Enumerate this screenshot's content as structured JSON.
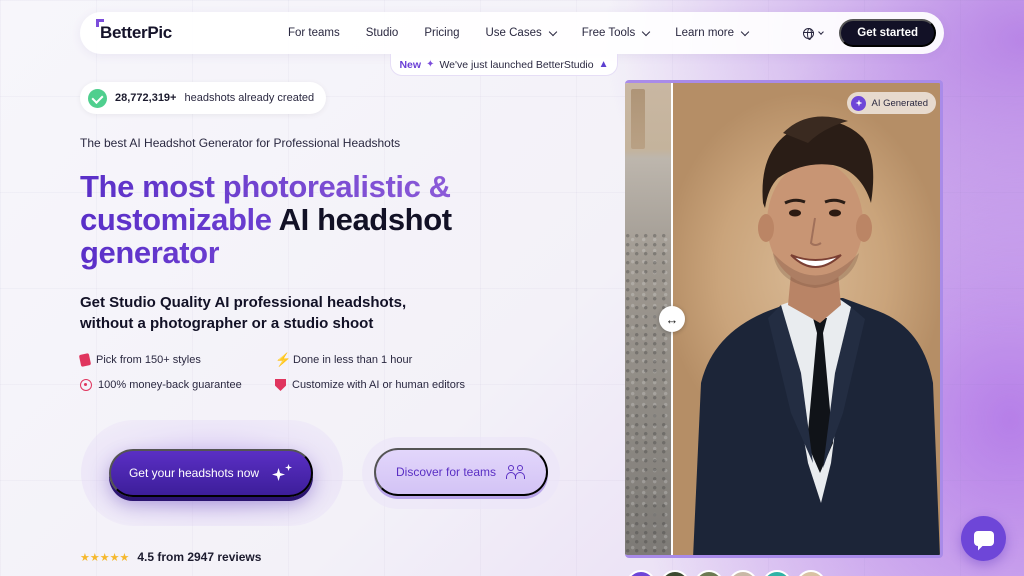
{
  "nav": {
    "logo": "BetterPic",
    "links": [
      {
        "label": "For teams",
        "dropdown": false
      },
      {
        "label": "Studio",
        "dropdown": false
      },
      {
        "label": "Pricing",
        "dropdown": false
      },
      {
        "label": "Use Cases",
        "dropdown": true
      },
      {
        "label": "Free Tools",
        "dropdown": true
      },
      {
        "label": "Learn more",
        "dropdown": true
      }
    ],
    "cta": "Get started"
  },
  "announcement": {
    "tag": "New",
    "message": "We've just launched BetterStudio"
  },
  "counter": {
    "number": "28,772,319+",
    "label": "headshots already created"
  },
  "hero": {
    "subtitle": "The best AI Headshot Generator for Professional Headshots",
    "headline_part1": "The most photorealistic & ",
    "headline_part2": "customizable",
    "headline_part3": " AI headshot ",
    "headline_part4": "generator",
    "lead_line1": "Get Studio Quality AI professional headshots,",
    "lead_line2": "without a photographer or a studio shoot"
  },
  "features": [
    {
      "icon": "tag-icon",
      "label": "Pick from 150+ styles"
    },
    {
      "icon": "bolt-icon",
      "label": "Done in less than 1 hour"
    },
    {
      "icon": "badge-icon",
      "label": "100% money-back guarantee"
    },
    {
      "icon": "shield-icon",
      "label": "Customize with AI or human editors"
    }
  ],
  "cta": {
    "primary": "Get your headshots now",
    "secondary": "Discover for teams"
  },
  "reviews": {
    "stars": "★★★★★",
    "rating": 4.5,
    "text": "4.5 from 2947 reviews"
  },
  "image": {
    "tag": "AI Generated",
    "handle": "↔"
  },
  "colors": {
    "brand": "#5a2fc4",
    "accent": "#6e46d8",
    "feature_icon": "#e0355e",
    "dark": "#121126"
  }
}
